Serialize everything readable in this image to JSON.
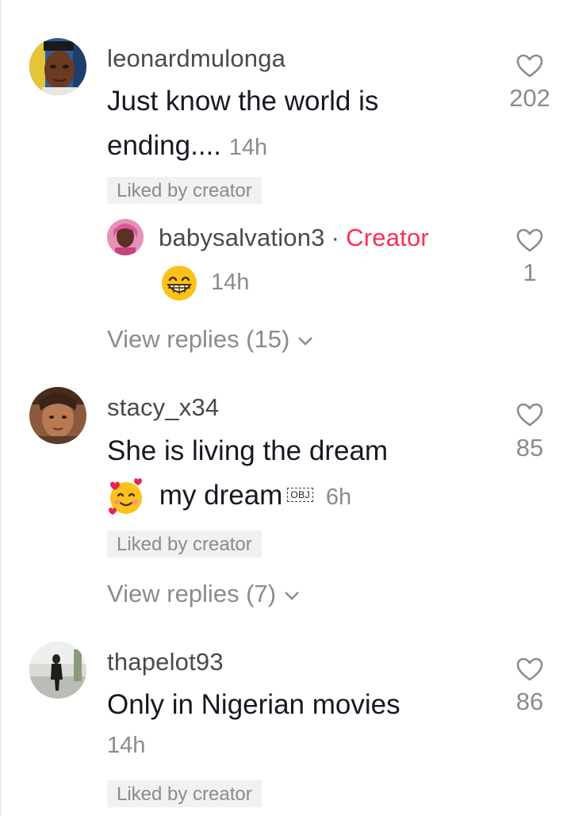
{
  "comments": [
    {
      "username": "leonardmulonga",
      "text_line1": "Just know the world is",
      "text_line2": "ending....",
      "time": "14h",
      "likes": "202",
      "liked_by_creator": "Liked by creator",
      "reply": {
        "username": "babysalvation3",
        "separator": "·",
        "badge": "Creator",
        "emoji": "grinning-face",
        "time": "14h",
        "likes": "1"
      },
      "view_replies": "View replies (15)"
    },
    {
      "username": "stacy_x34",
      "text_line1": "She is living the dream",
      "emoji": "smiling-face-with-hearts",
      "text_line2": "my dream",
      "obj_marker": "OBJ",
      "time": "6h",
      "likes": "85",
      "liked_by_creator": "Liked by creator",
      "view_replies": "View replies (7)"
    },
    {
      "username": "thapelot93",
      "text_line1": "Only in Nigerian movies",
      "time": "14h",
      "likes": "86",
      "liked_by_creator": "Liked by creator"
    }
  ],
  "colors": {
    "creator": "#fe2c55",
    "muted": "#8a8b91",
    "text": "#161823"
  }
}
